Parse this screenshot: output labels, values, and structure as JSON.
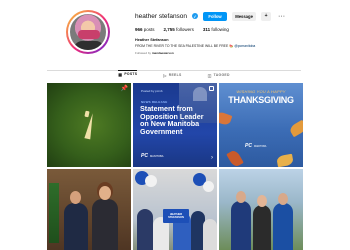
{
  "profile": {
    "username": "heather stefanson",
    "verified_icon": "verified-badge-icon",
    "follow_label": "Follow",
    "message_label": "Message",
    "suggest_icon": "add-person-icon",
    "more_icon": "more-options-icon",
    "stats": {
      "posts_count": "966",
      "posts_label": "posts",
      "followers_count": "2,755",
      "followers_label": "followers",
      "following_count": "311",
      "following_label": "following"
    },
    "bio": {
      "name": "Heather Stefanson",
      "text": "FROM THE RIVER TO THE SEA PALESTINE WILL BE FREE 🍉",
      "tag": "@pcmanitoba",
      "followed_prefix": "Followed by",
      "followed_by": "mandaewarson"
    }
  },
  "tabs": [
    {
      "label": "POSTS",
      "icon": "grid-icon",
      "active": true
    },
    {
      "label": "REELS",
      "icon": "reels-icon",
      "active": false
    },
    {
      "label": "TAGGED",
      "icon": "tagged-icon",
      "active": false
    }
  ],
  "posts": {
    "p1": {
      "pin_icon": "pin-icon"
    },
    "p2": {
      "small_tag": "Posted by pcmb",
      "kicker": "NEWS RELEASE",
      "headline": "Statement from Opposition Leader on New Manitoba Government",
      "logo": "PC",
      "logo_sub": "MANITOBA"
    },
    "p3": {
      "wish": "WISHING YOU A HAPPY",
      "headline": "THANKSGIVING",
      "logo": "PC",
      "logo_sub": "MANITOBA"
    },
    "p5": {
      "sign": "HEATHER STEFANSON"
    }
  },
  "colors": {
    "follow_blue": "#0095f6",
    "pc_blue": "#1b3a8f",
    "verified": "#1d9bf0"
  }
}
